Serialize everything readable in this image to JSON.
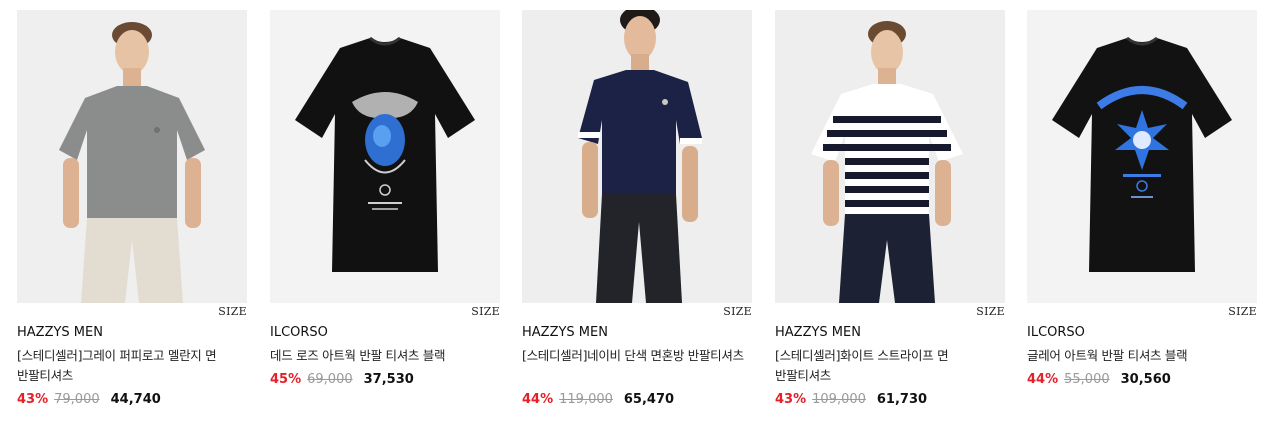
{
  "products": [
    {
      "brand": "HAZZYS MEN",
      "name": "[스테디셀러]그레이 퍼피로고 멜란지 면 반팔티셔츠",
      "discount": "43%",
      "original_price": "79,000",
      "sale_price": "44,740",
      "size_label": "SIZE",
      "image": "model-grey-tshirt"
    },
    {
      "brand": "ILCORSO",
      "name": "데드 로즈 아트웍 반팔 티셔츠 블랙",
      "discount": "45%",
      "original_price": "69,000",
      "sale_price": "37,530",
      "size_label": "SIZE",
      "image": "black-tshirt-blue-rose-graphic"
    },
    {
      "brand": "HAZZYS MEN",
      "name": "[스테디셀러]네이비 단색 면혼방 반팔티셔츠",
      "discount": "44%",
      "original_price": "119,000",
      "sale_price": "65,470",
      "size_label": "SIZE",
      "image": "model-navy-tshirt"
    },
    {
      "brand": "HAZZYS MEN",
      "name": "[스테디셀러]화이트 스트라이프 면 반팔티셔츠",
      "discount": "43%",
      "original_price": "109,000",
      "sale_price": "61,730",
      "size_label": "SIZE",
      "image": "model-white-stripe-tshirt"
    },
    {
      "brand": "ILCORSO",
      "name": "글레어 아트웍 반팔 티셔츠 블랙",
      "discount": "44%",
      "original_price": "55,000",
      "sale_price": "30,560",
      "size_label": "SIZE",
      "image": "black-tshirt-opalescence-graphic"
    }
  ],
  "colors": {
    "discount": "#e4202a",
    "original_price": "#9a9a9a",
    "text": "#111111",
    "image_bg": "#efefef"
  }
}
